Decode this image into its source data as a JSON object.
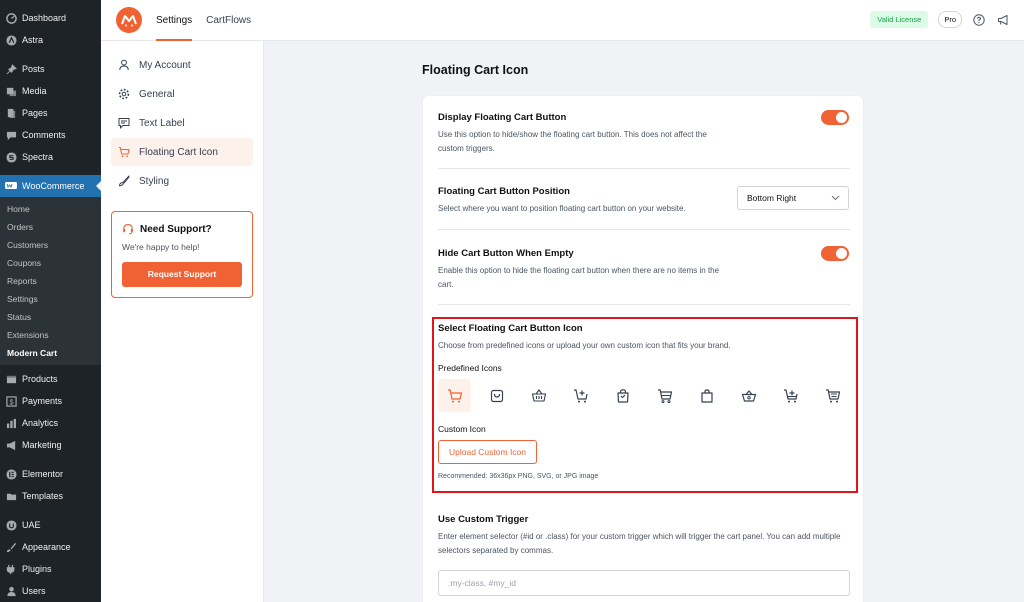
{
  "wp_menu": {
    "items_top": [
      {
        "label": "Dashboard",
        "icon": "dashboard-icon"
      },
      {
        "label": "Astra",
        "icon": "astra-icon"
      },
      {
        "label": "Posts",
        "icon": "pin-icon"
      },
      {
        "label": "Media",
        "icon": "media-icon"
      },
      {
        "label": "Pages",
        "icon": "pages-icon"
      },
      {
        "label": "Comments",
        "icon": "comment-icon"
      },
      {
        "label": "Spectra",
        "icon": "spectra-icon"
      }
    ],
    "woocommerce": {
      "label": "WooCommerce",
      "icon": "woocommerce-icon"
    },
    "woo_sub": [
      "Home",
      "Orders",
      "Customers",
      "Coupons",
      "Reports",
      "Settings",
      "Status",
      "Extensions",
      "Modern Cart"
    ],
    "items_bottom": [
      {
        "label": "Products",
        "icon": "products-icon"
      },
      {
        "label": "Payments",
        "icon": "payments-icon"
      },
      {
        "label": "Analytics",
        "icon": "analytics-icon"
      },
      {
        "label": "Marketing",
        "icon": "megaphone-icon"
      },
      {
        "label": "Elementor",
        "icon": "elementor-icon"
      },
      {
        "label": "Templates",
        "icon": "folder-icon"
      },
      {
        "label": "UAE",
        "icon": "uae-icon"
      },
      {
        "label": "Appearance",
        "icon": "brush-icon"
      },
      {
        "label": "Plugins",
        "icon": "plugin-icon"
      },
      {
        "label": "Users",
        "icon": "user-icon"
      }
    ]
  },
  "topbar": {
    "tabs": [
      "Settings",
      "CartFlows"
    ],
    "license": "Valid License",
    "pro": "Pro"
  },
  "settings_nav": {
    "items": [
      {
        "label": "My Account",
        "icon": "user-icon"
      },
      {
        "label": "General",
        "icon": "gear-icon"
      },
      {
        "label": "Text Label",
        "icon": "message-icon"
      },
      {
        "label": "Floating Cart Icon",
        "icon": "cart-icon"
      },
      {
        "label": "Styling",
        "icon": "brush-icon"
      }
    ],
    "support": {
      "title": "Need Support?",
      "subtitle": "We're happy to help!",
      "button": "Request Support"
    }
  },
  "main": {
    "title": "Floating Cart Icon",
    "display": {
      "title": "Display Floating Cart Button",
      "desc": "Use this option to hide/show the floating cart button. This does not affect the custom triggers.",
      "enabled": true
    },
    "position": {
      "title": "Floating Cart Button Position",
      "desc": "Select where you want to position floating cart button on your website.",
      "value": "Bottom Right"
    },
    "hide_empty": {
      "title": "Hide Cart Button When Empty",
      "desc": "Enable this option to hide the floating cart button when there are no items in the cart.",
      "enabled": true
    },
    "icon_select": {
      "title": "Select Floating Cart Button Icon",
      "desc": "Choose from predefined icons or upload your own custom icon that fits your brand.",
      "predefined_label": "Predefined Icons",
      "custom_label": "Custom Icon",
      "upload_button": "Upload Custom Icon",
      "recommendation": "Recommended: 36x36px PNG, SVG, or JPG image"
    },
    "trigger": {
      "title": "Use Custom Trigger",
      "desc": "Enter element selector (#id or .class) for your custom trigger which will trigger the cart panel. You can add multiple selectors separated by commas.",
      "placeholder": ".my-class, #my_id"
    }
  },
  "colors": {
    "accent": "#f06233",
    "wp_sidebar": "#1d2327",
    "wp_active": "#2271b1",
    "highlight": "#e0151b"
  }
}
